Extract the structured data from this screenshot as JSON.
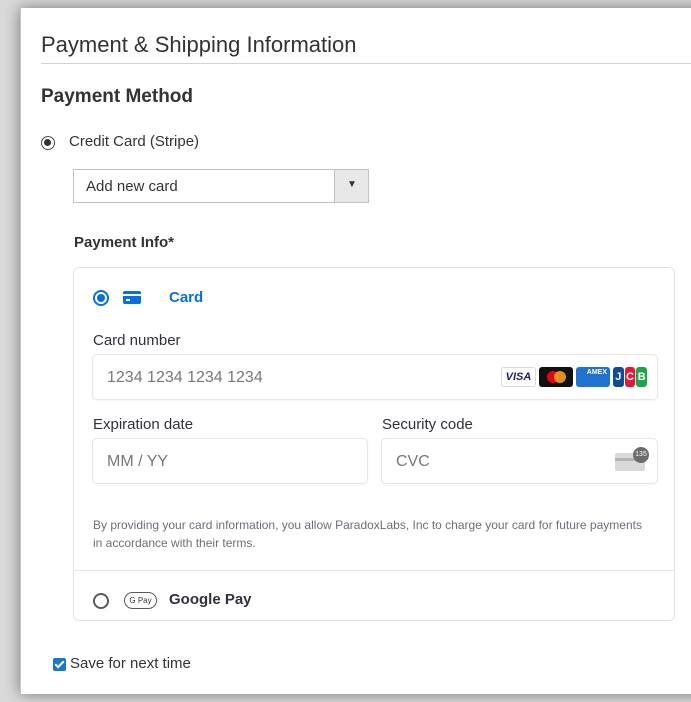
{
  "section": {
    "title": "Payment & Shipping Information"
  },
  "payment_method": {
    "title": "Payment Method",
    "option_label": "Credit Card (Stripe)",
    "card_select_value": "Add new card",
    "payment_info_label": "Payment Info*"
  },
  "stripe": {
    "card_tab_label": "Card",
    "card_number_label": "Card number",
    "card_number_placeholder": "1234 1234 1234 1234",
    "expiration_label": "Expiration date",
    "expiration_placeholder": "MM / YY",
    "security_label": "Security code",
    "security_placeholder": "CVC",
    "cvc_icon_number": "135",
    "brands": [
      "VISA",
      "Mastercard",
      "AMEX",
      "JCB"
    ],
    "legal_text": "By providing your card information, you allow ParadoxLabs, Inc to charge your card for future payments in accordance with their terms.",
    "gpay_badge": "G Pay",
    "gpay_label": "Google Pay"
  },
  "save": {
    "label": "Save for next time",
    "checked": true
  },
  "colors": {
    "stripe_accent": "#0570de",
    "checkbox": "#1979c3",
    "text": "#333333"
  },
  "icons": {
    "card_tab": "credit-card-icon",
    "cvc": "cvc-card-icon",
    "select": "chevron-down-icon"
  }
}
